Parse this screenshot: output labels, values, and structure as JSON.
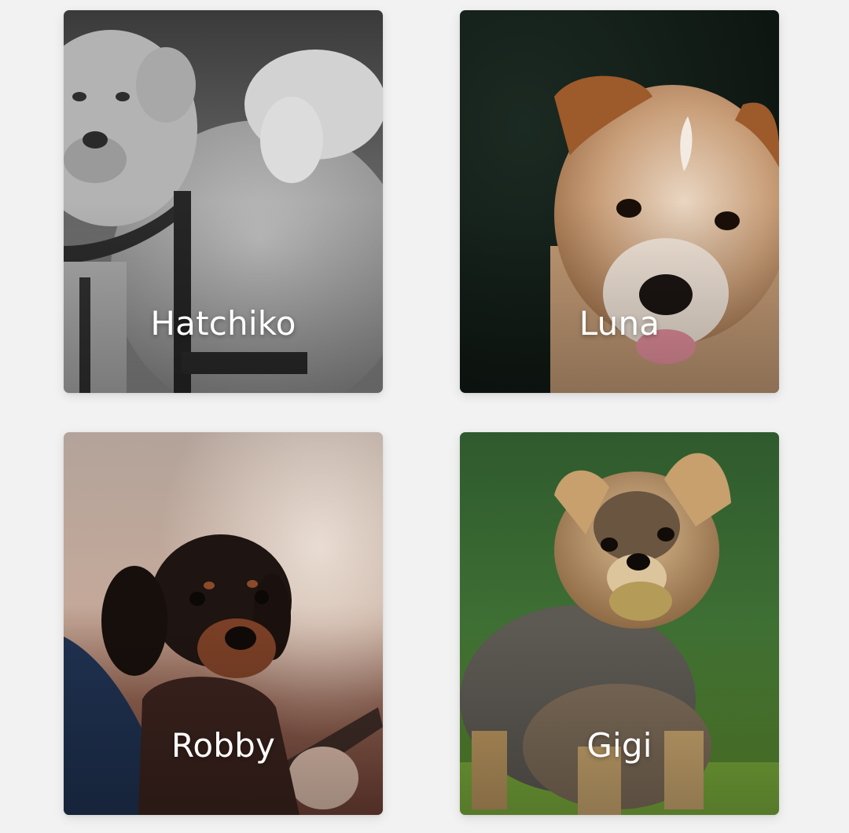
{
  "colors": {
    "page_background": "#f2f2f2",
    "label": "#ffffff"
  },
  "cards": [
    {
      "name": "Hatchiko",
      "image": "grayscale-akita-dog-photo"
    },
    {
      "name": "Luna",
      "image": "tan-puppy-photo"
    },
    {
      "name": "Robby",
      "image": "dachshund-puppy-photo"
    },
    {
      "name": "Gigi",
      "image": "yorkshire-terrier-photo"
    }
  ]
}
